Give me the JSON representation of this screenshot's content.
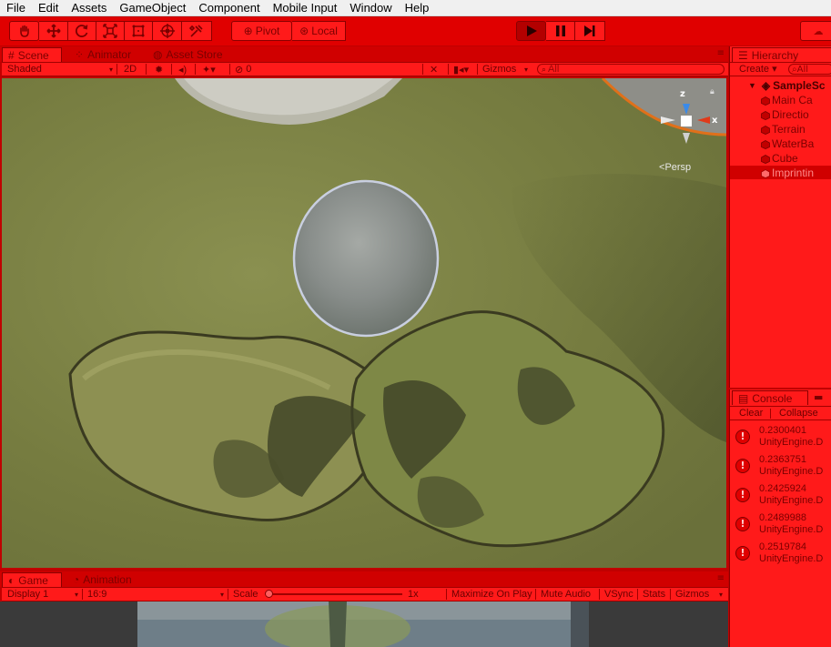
{
  "menu": {
    "items": [
      "File",
      "Edit",
      "Assets",
      "GameObject",
      "Component",
      "Mobile Input",
      "Window",
      "Help"
    ]
  },
  "toolbar": {
    "tools": [
      "hand-icon",
      "move-icon",
      "rotate-icon",
      "scale-icon",
      "rect-icon",
      "transform-icon",
      "custom-tool-icon"
    ],
    "pivot_label": "Pivot",
    "space_label": "Local",
    "play_icon": "play-icon",
    "pause_icon": "pause-icon",
    "step_icon": "step-icon"
  },
  "scene_tabs": {
    "scene": "Scene",
    "animator": "Animator",
    "asset_store": "Asset Store"
  },
  "scene_bar": {
    "shading": "Shaded",
    "mode_2d": "2D",
    "hidden_count": "0",
    "gizmos": "Gizmos",
    "search_placeholder": "All"
  },
  "gizmo": {
    "z_label": "z",
    "x_label": "x",
    "persp_label": "Persp"
  },
  "hierarchy": {
    "title": "Hierarchy",
    "create": "Create",
    "search_placeholder": "All",
    "scene_name": "SampleSc",
    "items": [
      "Main Ca",
      "Directio",
      "Terrain",
      "WaterBa",
      "Cube",
      "Imprintin"
    ]
  },
  "console": {
    "title": "Console",
    "clear": "Clear",
    "collapse": "Collapse",
    "entries": [
      {
        "value": "0.2300401",
        "source": "UnityEngine.D"
      },
      {
        "value": "0.2363751",
        "source": "UnityEngine.D"
      },
      {
        "value": "0.2425924",
        "source": "UnityEngine.D"
      },
      {
        "value": "0.2489988",
        "source": "UnityEngine.D"
      },
      {
        "value": "0.2519784",
        "source": "UnityEngine.D"
      }
    ]
  },
  "game_tabs": {
    "game": "Game",
    "animation": "Animation"
  },
  "game_bar": {
    "display": "Display 1",
    "aspect": "16:9",
    "scale_label": "Scale",
    "scale_value": "1x",
    "maximize": "Maximize On Play",
    "mute": "Mute Audio",
    "vsync": "VSync",
    "stats": "Stats",
    "gizmos": "Gizmos"
  },
  "colors": {
    "playmode_tint": "#ff1a1a",
    "terrain": "#7c8346"
  }
}
